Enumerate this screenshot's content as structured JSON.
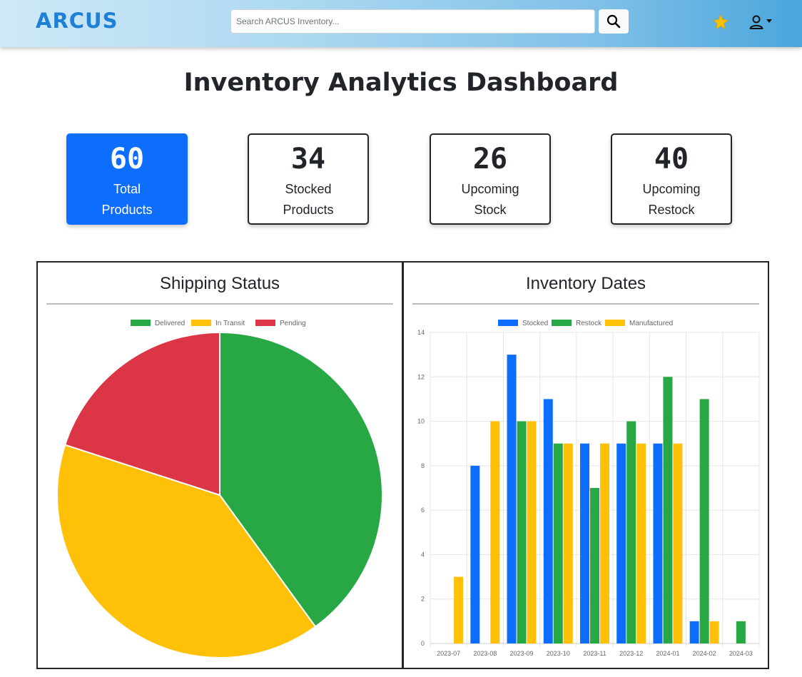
{
  "header": {
    "brand": "ARCUS",
    "search_placeholder": "Search ARCUS Inventory..."
  },
  "page": {
    "title": "Inventory Analytics Dashboard"
  },
  "stats": [
    {
      "value": "60",
      "label": "Total Products",
      "highlight": true
    },
    {
      "value": "34",
      "label": "Stocked Products",
      "highlight": false
    },
    {
      "value": "26",
      "label": "Upcoming Stock",
      "highlight": false
    },
    {
      "value": "40",
      "label": "Upcoming Restock",
      "highlight": false
    }
  ],
  "colors": {
    "primary": "#0d6efd",
    "green": "#28a745",
    "yellow": "#ffc107",
    "red": "#dc3545",
    "star": "#ffc107"
  },
  "icons": {
    "search": "search-icon",
    "favorite": "star-icon",
    "user": "user-icon",
    "dropdown": "caret-down-icon"
  },
  "charts": {
    "shipping": {
      "title": "Shipping Status"
    },
    "inventory": {
      "title": "Inventory Dates"
    }
  },
  "chart_data": [
    {
      "type": "pie",
      "title": "Shipping Status",
      "legend_position": "top",
      "labels": [
        "Delivered",
        "In Transit",
        "Pending"
      ],
      "values": [
        24,
        24,
        12
      ],
      "colors": [
        "#28a745",
        "#ffc107",
        "#dc3545"
      ]
    },
    {
      "type": "bar",
      "title": "Inventory Dates",
      "legend_position": "top",
      "categories": [
        "2023-07",
        "2023-08",
        "2023-09",
        "2023-10",
        "2023-11",
        "2023-12",
        "2024-01",
        "2024-02",
        "2024-03"
      ],
      "series": [
        {
          "name": "Stocked",
          "color": "#0d6efd",
          "values": [
            0,
            8,
            13,
            11,
            9,
            9,
            9,
            1,
            0
          ]
        },
        {
          "name": "Restock",
          "color": "#28a745",
          "values": [
            0,
            0,
            10,
            9,
            7,
            10,
            12,
            11,
            1
          ]
        },
        {
          "name": "Manufactured",
          "color": "#ffc107",
          "values": [
            3,
            10,
            10,
            9,
            9,
            9,
            9,
            1,
            0
          ]
        }
      ],
      "ylim": [
        0,
        14
      ],
      "yticks": [
        0,
        2,
        4,
        6,
        8,
        10,
        12,
        14
      ],
      "grid": true
    }
  ]
}
